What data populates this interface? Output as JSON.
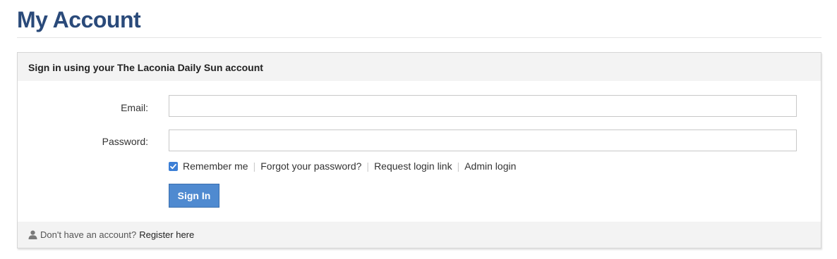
{
  "page": {
    "title": "My Account"
  },
  "panel": {
    "header": "Sign in using your The Laconia Daily Sun account"
  },
  "form": {
    "email_label": "Email:",
    "email_value": "",
    "password_label": "Password:",
    "password_value": "",
    "remember_me_label": "Remember me",
    "remember_me_checked": true,
    "forgot_password_link": "Forgot your password?",
    "request_login_link": "Request login link",
    "admin_login_link": "Admin login",
    "signin_button": "Sign In"
  },
  "footer": {
    "no_account_text": "Don't have an account?",
    "register_link": "Register here",
    "icon": "user-icon"
  },
  "colors": {
    "title": "#2a4a7a",
    "button": "#4f8ad0",
    "checkbox": "#3c7fd6",
    "panel_bg": "#f3f3f3"
  }
}
